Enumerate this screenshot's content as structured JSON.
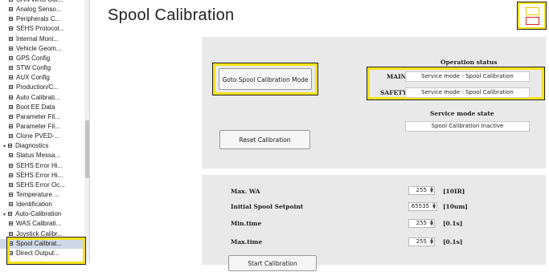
{
  "sidebar": {
    "items": [
      {
        "label": "CAN WAS Cal...",
        "group": false
      },
      {
        "label": "Analog Senso...",
        "group": false
      },
      {
        "label": "Peripherals C...",
        "group": false
      },
      {
        "label": "SEHS Protocol...",
        "group": false
      },
      {
        "label": "Internal Moni...",
        "group": false
      },
      {
        "label": "Vehicle Geom...",
        "group": false
      },
      {
        "label": "GPS Config",
        "group": false
      },
      {
        "label": "STW Config",
        "group": false
      },
      {
        "label": "AUX Config",
        "group": false
      },
      {
        "label": "Production/C...",
        "group": false
      },
      {
        "label": "Auto Calibrati...",
        "group": false
      },
      {
        "label": "Boot EE Data",
        "group": false
      },
      {
        "label": "Parameter Fil...",
        "group": false
      },
      {
        "label": "Parameter Fil...",
        "group": false
      },
      {
        "label": "Clone PVED-...",
        "group": false
      },
      {
        "label": "Diagnostics",
        "group": true
      },
      {
        "label": "Status Messa...",
        "group": false
      },
      {
        "label": "SEHS Error Hi...",
        "group": false
      },
      {
        "label": "SEHS Error Hi...",
        "group": false
      },
      {
        "label": "SEHS Error Oc...",
        "group": false
      },
      {
        "label": "Temperature ...",
        "group": false
      },
      {
        "label": "Identification",
        "group": false
      },
      {
        "label": "Auto-Calibration",
        "group": true
      },
      {
        "label": "WAS Calibrati...",
        "group": false
      },
      {
        "label": "Joystick Calibr...",
        "group": false
      },
      {
        "label": "Spool Calibrat...",
        "group": false,
        "selected": true
      },
      {
        "label": "Direct Output...",
        "group": false
      }
    ]
  },
  "header": {
    "title": "Spool Calibration"
  },
  "calibration": {
    "goto_button": "Goto Spool Calibration Mode",
    "reset_button": "Reset Calibration",
    "operation_status_title": "Operation status",
    "main_label": "MAIN",
    "main_value": "Service mode - Spool Calibration",
    "safety_label": "SAFETY",
    "safety_value": "Service mode - Spool Calibration",
    "service_state_title": "Service mode state",
    "service_state_value": "Spool Calibration Inactive"
  },
  "params": {
    "rows": [
      {
        "label": "Max. WA",
        "value": "255",
        "unit": "[10IR]"
      },
      {
        "label": "Initial Spool Setpoint",
        "value": "65535",
        "unit": "[10um]"
      },
      {
        "label": "Min.time",
        "value": "255",
        "unit": "[0.1s]"
      },
      {
        "label": "Max.time",
        "value": "255",
        "unit": "[0.1s]"
      }
    ],
    "bottom_button": "Start Calibration"
  },
  "colors": {
    "highlight": "#f5e21a",
    "panel": "#e9e9e9",
    "selected": "#cfd8e6"
  }
}
